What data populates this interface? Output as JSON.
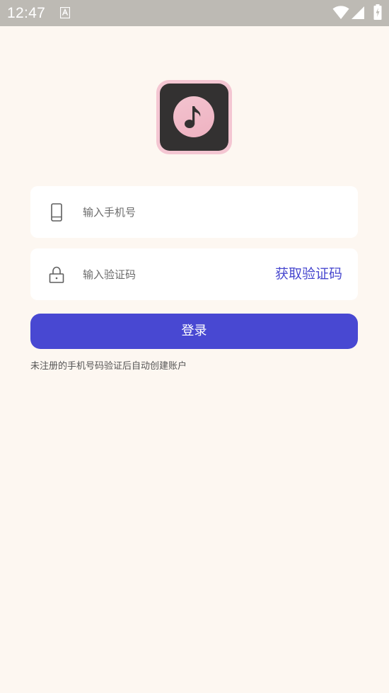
{
  "status_bar": {
    "time": "12:47",
    "icons": [
      "a-notification-icon",
      "wifi-icon",
      "signal-icon",
      "battery-charging-icon"
    ]
  },
  "logo": {
    "icon": "music-note-icon"
  },
  "form": {
    "phone": {
      "placeholder": "输入手机号",
      "value": "",
      "icon": "phone-icon"
    },
    "code": {
      "placeholder": "输入验证码",
      "value": "",
      "icon": "lock-icon",
      "get_code_label": "获取验证码"
    },
    "login_label": "登录",
    "hint": "未注册的手机号码验证后自动创建账户"
  },
  "colors": {
    "background": "#fdf7f1",
    "accent": "#4848d2",
    "logo_border": "#f4c6d2",
    "logo_dark": "#333131"
  }
}
